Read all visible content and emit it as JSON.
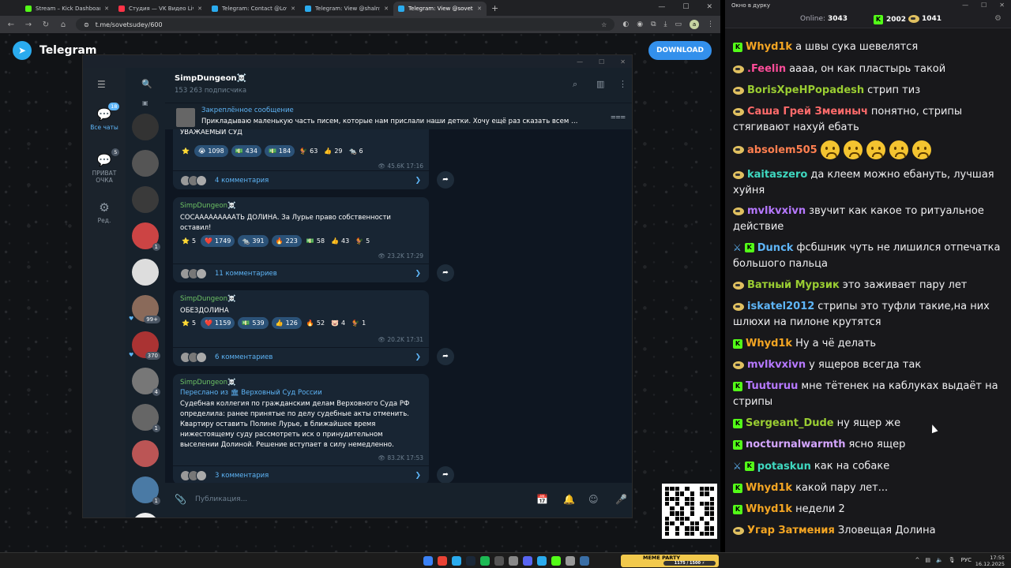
{
  "browser": {
    "tabs": [
      {
        "label": "Stream – Kick Dashboard",
        "color": "#53fc18",
        "active": false
      },
      {
        "label": "Студия — VK Видео Live",
        "color": "#ff3347",
        "active": false
      },
      {
        "label": "Telegram: Contact @Love_Russ…",
        "color": "#2aabee",
        "active": false
      },
      {
        "label": "Telegram: View @shalnyak",
        "color": "#2aabee",
        "active": false
      },
      {
        "label": "Telegram: View @sovetsudey",
        "color": "#2aabee",
        "active": true
      }
    ],
    "new_tab": "+",
    "url": "t.me/sovetsudey/600",
    "profile_initial": "a"
  },
  "tg_web": {
    "brand": "Telegram",
    "download": "DOWNLOAD"
  },
  "folders": [
    {
      "label": "Все чаты",
      "badge": "18",
      "icon": "💬",
      "active": true
    },
    {
      "label": "ПРИВАТ ОЧКА",
      "badge": "5",
      "icon": "💬",
      "active": false
    },
    {
      "label": "Ред.",
      "badge": "",
      "icon": "⚙",
      "active": false
    }
  ],
  "chat_list": [
    {
      "color": "#333",
      "badge": "",
      "heart": false
    },
    {
      "color": "#555",
      "badge": "",
      "heart": false
    },
    {
      "color": "#3a3a3a",
      "badge": "",
      "heart": false
    },
    {
      "color": "#c44",
      "badge": "1",
      "heart": false
    },
    {
      "color": "#ddd",
      "badge": "",
      "heart": false
    },
    {
      "color": "#8a6a5a",
      "badge": "99+",
      "heart": true
    },
    {
      "color": "#a33",
      "badge": "370",
      "heart": true
    },
    {
      "color": "#777",
      "badge": "4",
      "heart": false
    },
    {
      "color": "#666",
      "badge": "1",
      "heart": false
    },
    {
      "color": "#b55",
      "badge": "",
      "heart": false
    },
    {
      "color": "#4a7aa5",
      "badge": "1",
      "heart": false
    },
    {
      "color": "#eee",
      "badge": "1",
      "heart": false
    }
  ],
  "channel": {
    "title": "SimpDungeon☠️",
    "subscribers": "153 263 подписчика",
    "pinned_title": "Закреплённое сообщение",
    "pinned_text": "Прикладываю маленькую часть писем, которые нам прислали наши детки.   Хочу ещё раз сказать всем …"
  },
  "messages": [
    {
      "name": "",
      "text": "УВАЖАЕМЫЙ СУД",
      "reactions": [
        {
          "e": "⭐",
          "n": "",
          "plain": true
        },
        {
          "e": "😭",
          "n": "1098"
        },
        {
          "e": "💵",
          "n": "434"
        },
        {
          "e": "💵",
          "n": "184"
        },
        {
          "e": "🐓",
          "n": "63",
          "plain": true
        },
        {
          "e": "👍",
          "n": "29",
          "plain": true
        },
        {
          "e": "🐀",
          "n": "6",
          "plain": true
        }
      ],
      "views": "👁 45.6K",
      "time": "17:16",
      "comments": "4 комментария"
    },
    {
      "name": "SimpDungeon☠️",
      "text": "СОСАААААААААТЬ ДОЛИНА. За Лурье право собственности оставил!",
      "reactions": [
        {
          "e": "⭐",
          "n": "5",
          "plain": true
        },
        {
          "e": "❤️",
          "n": "1749"
        },
        {
          "e": "🐀",
          "n": "391"
        },
        {
          "e": "🔥",
          "n": "223"
        },
        {
          "e": "💵",
          "n": "58",
          "plain": true
        },
        {
          "e": "👍",
          "n": "43",
          "plain": true
        },
        {
          "e": "🐓",
          "n": "5",
          "plain": true
        }
      ],
      "views": "👁 23.2K",
      "time": "17:29",
      "comments": "11 комментариев"
    },
    {
      "name": "SimpDungeon☠️",
      "text": "ОБЕЗДОЛИНА",
      "reactions": [
        {
          "e": "⭐",
          "n": "5",
          "plain": true
        },
        {
          "e": "❤️",
          "n": "1159"
        },
        {
          "e": "💵",
          "n": "539"
        },
        {
          "e": "👍",
          "n": "126"
        },
        {
          "e": "🔥",
          "n": "52",
          "plain": true
        },
        {
          "e": "🐷",
          "n": "4",
          "plain": true
        },
        {
          "e": "🐓",
          "n": "1",
          "plain": true
        }
      ],
      "views": "👁 20.2K",
      "time": "17:31",
      "comments": "6 комментариев"
    },
    {
      "name": "SimpDungeon☠️",
      "fwd": "Переслано из 🏛 Верховный Суд России",
      "text": "Судебная коллегия по гражданским делам Верховного Суда РФ определила: ранее принятые по делу судебные акты отменить. Квартиру оставить Полине Лурье, в ближайшее время нижестоящему суду рассмотреть иск о принудительном выселении Долиной. Решение вступает в силу немедленно.",
      "reactions": [],
      "views": "👁 83.2K",
      "time": "17:53",
      "comments": "3 комментария"
    }
  ],
  "input": {
    "placeholder": "Публикация..."
  },
  "stream_chat": {
    "window_title": "Окно в дурку",
    "online_label": "Online:",
    "online": "3043",
    "kick_count": "2002",
    "dog_count": "1041",
    "lines": [
      {
        "user": "Whyd1k",
        "color": "#f5a623",
        "badges": [
          "kick"
        ],
        "text": "а швы сука шевелятся"
      },
      {
        "user": ".Feelin",
        "color": "#ff4d9a",
        "badges": [
          "dog"
        ],
        "text": "аааа, он как пластырь такой"
      },
      {
        "user": "BorisXpeHPopadesh",
        "color": "#9acd32",
        "badges": [
          "dog"
        ],
        "text": "стрип тиз"
      },
      {
        "user": "Саша Грей Змеиныч",
        "color": "#ff6b6b",
        "badges": [
          "dog"
        ],
        "text": "понятно, стрипы стягивают нахуй ебать"
      },
      {
        "user": "absolem505",
        "color": "#ff7f50",
        "badges": [
          "dog"
        ],
        "text": "",
        "emotes": 5
      },
      {
        "user": "kaitaszero",
        "color": "#3fd8c0",
        "badges": [
          "dog"
        ],
        "text": "да клеем можно ебануть, лучшая хуйня"
      },
      {
        "user": "mvlkvxivn",
        "color": "#b678ff",
        "badges": [
          "dog"
        ],
        "text": "звучит как какое то ритуальное действие"
      },
      {
        "user": "Dunck",
        "color": "#5eb5f7",
        "badges": [
          "sword",
          "kick"
        ],
        "text": "фсбшник чуть не лишился отпечатка большого пальца"
      },
      {
        "user": "Ватный Мурзик",
        "color": "#9acd32",
        "badges": [
          "dog"
        ],
        "text": "это заживает пару лет"
      },
      {
        "user": "iskatel2012",
        "color": "#5eb5f7",
        "badges": [
          "dog"
        ],
        "text": "стрипы это туфли такие,на них шлюхи на пилоне крутятся"
      },
      {
        "user": "Whyd1k",
        "color": "#f5a623",
        "badges": [
          "kick"
        ],
        "text": "Ну а чё делать"
      },
      {
        "user": "mvlkvxivn",
        "color": "#b678ff",
        "badges": [
          "dog"
        ],
        "text": "у ящеров всегда так"
      },
      {
        "user": "Tuuturuu",
        "color": "#b678ff",
        "badges": [
          "kick"
        ],
        "text": "мне тётенек на каблуках выдаёт на стрипы"
      },
      {
        "user": "Sergeant_Dude",
        "color": "#9acd32",
        "badges": [
          "kick"
        ],
        "text": "ну ящер же"
      },
      {
        "user": "nocturnalwarmth",
        "color": "#d4a5ff",
        "badges": [
          "kick"
        ],
        "text": "ясно ящер"
      },
      {
        "user": "potaskun",
        "color": "#3fd8c0",
        "badges": [
          "sword",
          "kick"
        ],
        "text": "как на собаке"
      },
      {
        "user": "Whyd1k",
        "color": "#f5a623",
        "badges": [
          "kick"
        ],
        "text": "какой пару лет..."
      },
      {
        "user": "Whyd1k",
        "color": "#f5a623",
        "badges": [
          "kick"
        ],
        "text": "недели 2"
      },
      {
        "user": "Угар Затмения",
        "color": "#f5a623",
        "badges": [
          "dog"
        ],
        "text": "Зловещая Долина"
      }
    ]
  },
  "taskbar": {
    "lang": "РУС",
    "time": "17:55",
    "date": "16.12.2025",
    "meme_title": "MEME PARTY",
    "meme_progress": "1175 / 1500 ⚡"
  }
}
